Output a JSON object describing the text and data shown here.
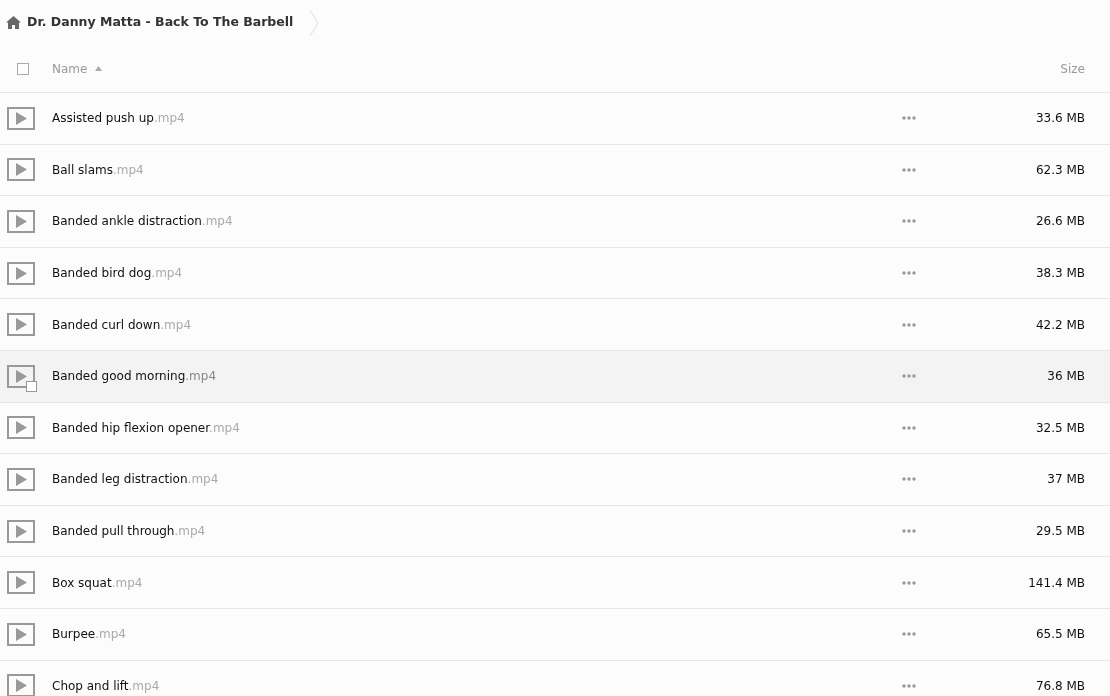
{
  "breadcrumb": {
    "title": "Dr. Danny Matta - Back To The Barbell"
  },
  "columns": {
    "select_all": {
      "checked": false
    },
    "name": "Name",
    "sort_ascending": true,
    "size": "Size"
  },
  "files": [
    {
      "name": "Assisted push up",
      "ext": ".mp4",
      "size": "33.6 MB",
      "hovered": false
    },
    {
      "name": "Ball slams",
      "ext": ".mp4",
      "size": "62.3 MB",
      "hovered": false
    },
    {
      "name": "Banded ankle distraction",
      "ext": ".mp4",
      "size": "26.6 MB",
      "hovered": false
    },
    {
      "name": "Banded bird dog",
      "ext": ".mp4",
      "size": "38.3 MB",
      "hovered": false
    },
    {
      "name": "Banded curl down",
      "ext": ".mp4",
      "size": "42.2 MB",
      "hovered": false
    },
    {
      "name": "Banded good morning",
      "ext": ".mp4",
      "size": "36 MB",
      "hovered": true
    },
    {
      "name": "Banded hip flexion opener",
      "ext": ".mp4",
      "size": "32.5 MB",
      "hovered": false
    },
    {
      "name": "Banded leg distraction",
      "ext": ".mp4",
      "size": "37 MB",
      "hovered": false
    },
    {
      "name": "Banded pull through",
      "ext": ".mp4",
      "size": "29.5 MB",
      "hovered": false
    },
    {
      "name": "Box squat",
      "ext": ".mp4",
      "size": "141.4 MB",
      "hovered": false
    },
    {
      "name": "Burpee",
      "ext": ".mp4",
      "size": "65.5 MB",
      "hovered": false
    },
    {
      "name": "Chop and lift",
      "ext": ".mp4",
      "size": "76.8 MB",
      "hovered": false
    }
  ]
}
